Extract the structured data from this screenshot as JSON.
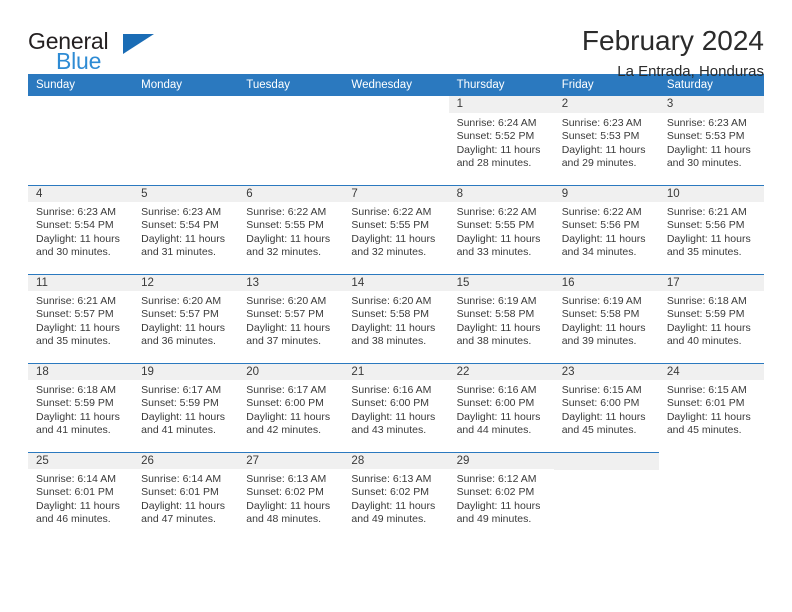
{
  "brand": {
    "name_top": "General",
    "name_bottom": "Blue",
    "triangle_icon": "blue-triangle-logo-mark",
    "color_dark": "#231f20",
    "color_blue": "#2e8bd4"
  },
  "header": {
    "title": "February 2024",
    "subtitle": "La Entrada, Honduras"
  },
  "theme": {
    "header_bg": "#2b79bf",
    "header_text": "#ffffff",
    "daynum_band_bg": "#f0f0f0",
    "rule_color": "#2b79bf",
    "body_text": "#3a3a3a"
  },
  "calendar": {
    "weekday_headers": [
      "Sunday",
      "Monday",
      "Tuesday",
      "Wednesday",
      "Thursday",
      "Friday",
      "Saturday"
    ],
    "weeks": [
      [
        {
          "empty": true
        },
        {
          "empty": true
        },
        {
          "empty": true
        },
        {
          "empty": true
        },
        {
          "day": "1",
          "sunrise": "Sunrise: 6:24 AM",
          "sunset": "Sunset: 5:52 PM",
          "daylight_1": "Daylight: 11 hours",
          "daylight_2": "and 28 minutes."
        },
        {
          "day": "2",
          "sunrise": "Sunrise: 6:23 AM",
          "sunset": "Sunset: 5:53 PM",
          "daylight_1": "Daylight: 11 hours",
          "daylight_2": "and 29 minutes."
        },
        {
          "day": "3",
          "sunrise": "Sunrise: 6:23 AM",
          "sunset": "Sunset: 5:53 PM",
          "daylight_1": "Daylight: 11 hours",
          "daylight_2": "and 30 minutes."
        }
      ],
      [
        {
          "day": "4",
          "sunrise": "Sunrise: 6:23 AM",
          "sunset": "Sunset: 5:54 PM",
          "daylight_1": "Daylight: 11 hours",
          "daylight_2": "and 30 minutes."
        },
        {
          "day": "5",
          "sunrise": "Sunrise: 6:23 AM",
          "sunset": "Sunset: 5:54 PM",
          "daylight_1": "Daylight: 11 hours",
          "daylight_2": "and 31 minutes."
        },
        {
          "day": "6",
          "sunrise": "Sunrise: 6:22 AM",
          "sunset": "Sunset: 5:55 PM",
          "daylight_1": "Daylight: 11 hours",
          "daylight_2": "and 32 minutes."
        },
        {
          "day": "7",
          "sunrise": "Sunrise: 6:22 AM",
          "sunset": "Sunset: 5:55 PM",
          "daylight_1": "Daylight: 11 hours",
          "daylight_2": "and 32 minutes."
        },
        {
          "day": "8",
          "sunrise": "Sunrise: 6:22 AM",
          "sunset": "Sunset: 5:55 PM",
          "daylight_1": "Daylight: 11 hours",
          "daylight_2": "and 33 minutes."
        },
        {
          "day": "9",
          "sunrise": "Sunrise: 6:22 AM",
          "sunset": "Sunset: 5:56 PM",
          "daylight_1": "Daylight: 11 hours",
          "daylight_2": "and 34 minutes."
        },
        {
          "day": "10",
          "sunrise": "Sunrise: 6:21 AM",
          "sunset": "Sunset: 5:56 PM",
          "daylight_1": "Daylight: 11 hours",
          "daylight_2": "and 35 minutes."
        }
      ],
      [
        {
          "day": "11",
          "sunrise": "Sunrise: 6:21 AM",
          "sunset": "Sunset: 5:57 PM",
          "daylight_1": "Daylight: 11 hours",
          "daylight_2": "and 35 minutes."
        },
        {
          "day": "12",
          "sunrise": "Sunrise: 6:20 AM",
          "sunset": "Sunset: 5:57 PM",
          "daylight_1": "Daylight: 11 hours",
          "daylight_2": "and 36 minutes."
        },
        {
          "day": "13",
          "sunrise": "Sunrise: 6:20 AM",
          "sunset": "Sunset: 5:57 PM",
          "daylight_1": "Daylight: 11 hours",
          "daylight_2": "and 37 minutes."
        },
        {
          "day": "14",
          "sunrise": "Sunrise: 6:20 AM",
          "sunset": "Sunset: 5:58 PM",
          "daylight_1": "Daylight: 11 hours",
          "daylight_2": "and 38 minutes."
        },
        {
          "day": "15",
          "sunrise": "Sunrise: 6:19 AM",
          "sunset": "Sunset: 5:58 PM",
          "daylight_1": "Daylight: 11 hours",
          "daylight_2": "and 38 minutes."
        },
        {
          "day": "16",
          "sunrise": "Sunrise: 6:19 AM",
          "sunset": "Sunset: 5:58 PM",
          "daylight_1": "Daylight: 11 hours",
          "daylight_2": "and 39 minutes."
        },
        {
          "day": "17",
          "sunrise": "Sunrise: 6:18 AM",
          "sunset": "Sunset: 5:59 PM",
          "daylight_1": "Daylight: 11 hours",
          "daylight_2": "and 40 minutes."
        }
      ],
      [
        {
          "day": "18",
          "sunrise": "Sunrise: 6:18 AM",
          "sunset": "Sunset: 5:59 PM",
          "daylight_1": "Daylight: 11 hours",
          "daylight_2": "and 41 minutes."
        },
        {
          "day": "19",
          "sunrise": "Sunrise: 6:17 AM",
          "sunset": "Sunset: 5:59 PM",
          "daylight_1": "Daylight: 11 hours",
          "daylight_2": "and 41 minutes."
        },
        {
          "day": "20",
          "sunrise": "Sunrise: 6:17 AM",
          "sunset": "Sunset: 6:00 PM",
          "daylight_1": "Daylight: 11 hours",
          "daylight_2": "and 42 minutes."
        },
        {
          "day": "21",
          "sunrise": "Sunrise: 6:16 AM",
          "sunset": "Sunset: 6:00 PM",
          "daylight_1": "Daylight: 11 hours",
          "daylight_2": "and 43 minutes."
        },
        {
          "day": "22",
          "sunrise": "Sunrise: 6:16 AM",
          "sunset": "Sunset: 6:00 PM",
          "daylight_1": "Daylight: 11 hours",
          "daylight_2": "and 44 minutes."
        },
        {
          "day": "23",
          "sunrise": "Sunrise: 6:15 AM",
          "sunset": "Sunset: 6:00 PM",
          "daylight_1": "Daylight: 11 hours",
          "daylight_2": "and 45 minutes."
        },
        {
          "day": "24",
          "sunrise": "Sunrise: 6:15 AM",
          "sunset": "Sunset: 6:01 PM",
          "daylight_1": "Daylight: 11 hours",
          "daylight_2": "and 45 minutes."
        }
      ],
      [
        {
          "day": "25",
          "sunrise": "Sunrise: 6:14 AM",
          "sunset": "Sunset: 6:01 PM",
          "daylight_1": "Daylight: 11 hours",
          "daylight_2": "and 46 minutes."
        },
        {
          "day": "26",
          "sunrise": "Sunrise: 6:14 AM",
          "sunset": "Sunset: 6:01 PM",
          "daylight_1": "Daylight: 11 hours",
          "daylight_2": "and 47 minutes."
        },
        {
          "day": "27",
          "sunrise": "Sunrise: 6:13 AM",
          "sunset": "Sunset: 6:02 PM",
          "daylight_1": "Daylight: 11 hours",
          "daylight_2": "and 48 minutes."
        },
        {
          "day": "28",
          "sunrise": "Sunrise: 6:13 AM",
          "sunset": "Sunset: 6:02 PM",
          "daylight_1": "Daylight: 11 hours",
          "daylight_2": "and 49 minutes."
        },
        {
          "day": "29",
          "sunrise": "Sunrise: 6:12 AM",
          "sunset": "Sunset: 6:02 PM",
          "daylight_1": "Daylight: 11 hours",
          "daylight_2": "and 49 minutes."
        },
        {
          "empty": true,
          "banded": true
        },
        {
          "empty": true
        }
      ]
    ]
  }
}
